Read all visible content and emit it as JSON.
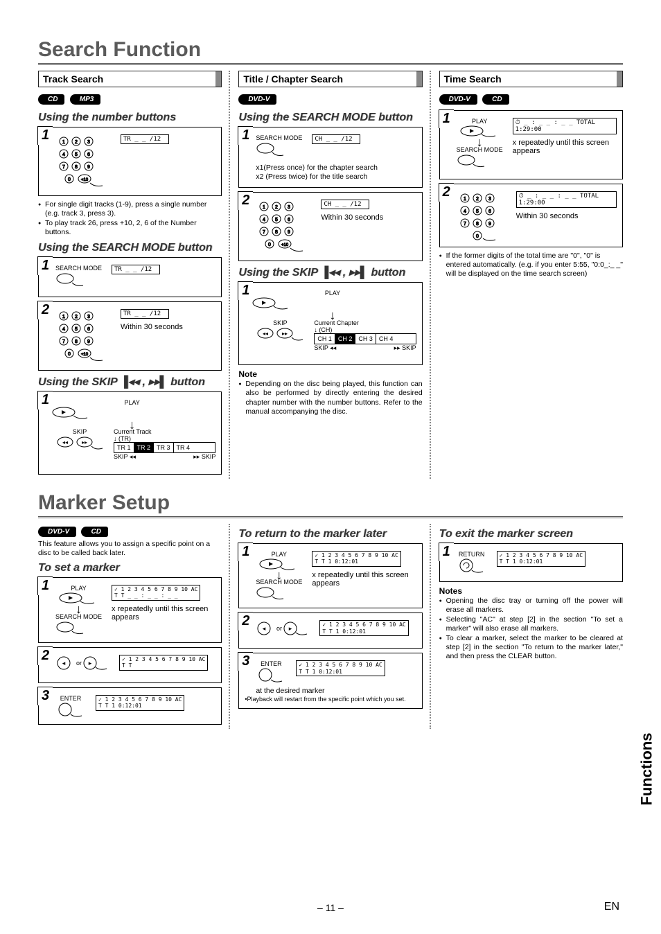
{
  "page": {
    "title1": "Search Function",
    "title2": "Marker Setup",
    "pageNumber": "– 11 –",
    "lang": "EN",
    "sideTab": "Functions"
  },
  "search": {
    "track": {
      "header": "Track Search",
      "badges": [
        "CD",
        "MP3"
      ],
      "numberButtons": {
        "title": "Using the number buttons",
        "display": "TR   _ _ /12",
        "notes": [
          "For single digit tracks (1-9), press a single number (e.g. track 3, press 3).",
          "To play track 26, press +10, 2, 6 of the Number buttons."
        ]
      },
      "searchMode": {
        "title": "Using the SEARCH MODE button",
        "btnLabel": "SEARCH MODE",
        "display": "TR   _ _ /12",
        "within": "Within 30 seconds"
      },
      "skip": {
        "title_pre": "Using the SKIP ",
        "title_post": " button",
        "playLabel": "PLAY",
        "skipLabel": "SKIP",
        "currentLabel": "Current Track",
        "unit": "(TR)",
        "cells": [
          "TR 1",
          "TR 2",
          "TR 3",
          "TR 4"
        ],
        "leftLabel": "SKIP ◂◂",
        "rightLabel": "▸▸ SKIP"
      }
    },
    "titleChapter": {
      "header": "Title / Chapter Search",
      "badges": [
        "DVD-V"
      ],
      "searchMode": {
        "title": "Using the SEARCH MODE button",
        "btnLabel": "SEARCH MODE",
        "display": "CH   _ _ /12",
        "line1": "x1(Press once) for the chapter search",
        "line2": "x2 (Press twice) for the title search",
        "within": "Within 30 seconds"
      },
      "skip": {
        "title_pre": "Using the SKIP ",
        "title_post": " button",
        "playLabel": "PLAY",
        "skipLabel": "SKIP",
        "currentLabel": "Current Chapter",
        "unit": "(CH)",
        "cells": [
          "CH 1",
          "CH 2",
          "CH 3",
          "CH 4"
        ],
        "leftLabel": "SKIP ◂◂",
        "rightLabel": "▸▸ SKIP"
      },
      "note": {
        "title": "Note",
        "text": "Depending on the disc being played, this function can also be performed by directly entering the desired chapter number with the number buttons. Refer to the manual accompanying the disc."
      }
    },
    "time": {
      "header": "Time Search",
      "badges": [
        "DVD-V",
        "CD"
      ],
      "step1": {
        "playLabel": "PLAY",
        "btnLabel": "SEARCH MODE",
        "display": "⏱ _ : _ _ : _ _   TOTAL 1:29:00",
        "hint": "x repeatedly until this screen appears"
      },
      "step2": {
        "display": "⏱ _ : _ _ : _ _   TOTAL 1:29:00",
        "within": "Within 30 seconds"
      },
      "note": "If the former digits of the total time are \"0\", \"0\" is entered automatically. (e.g. if you enter 5:55, \"0:0_:_ _\" will be displayed on the time search screen)"
    }
  },
  "marker": {
    "intro": {
      "badges": [
        "DVD-V",
        "CD"
      ],
      "text": "This feature allows you to assign a specific point on a disc to be called back later."
    },
    "set": {
      "title": "To set a marker",
      "playLabel": "PLAY",
      "btnLabel": "SEARCH MODE",
      "hint": "x repeatedly until this screen appears",
      "orLabel": "or",
      "enterLabel": "ENTER",
      "disp1": {
        "row": "✓ 1 2 3 4 5 6 7 8 9 10 AC",
        "line": "T T  _ _ : _ _ : _ _"
      },
      "disp2": {
        "row": "✓ 1 2 3 4 5 6 7 8 9 10 AC",
        "line": "T T"
      },
      "disp3": {
        "row": "✓ 1 2 3 4 5 6 7 8 9 10 AC",
        "line": "T T   1   0:12:01"
      }
    },
    "return": {
      "title": "To return to the marker later",
      "playLabel": "PLAY",
      "btnLabel": "SEARCH MODE",
      "hint": "x repeatedly until this screen appears",
      "orLabel": "or",
      "enterLabel": "ENTER",
      "atDesired": "at the desired marker",
      "playbackNote": "Playback will restart from the specific point which you set.",
      "disp1": {
        "row": "✓ 1 2 3 4 5 6 7 8 9 10 AC",
        "line": "T T   1   0:12:01"
      },
      "disp2": {
        "row": "✓ 1 2 3 4 5 6 7 8 9 10 AC",
        "line": "T T   1   0:12:01"
      },
      "disp3": {
        "row": "✓ 1 2 3 4 5 6 7 8 9 10 AC",
        "line": "T T   1   0:12:01"
      }
    },
    "exit": {
      "title": "To exit the marker screen",
      "returnLabel": "RETURN",
      "disp": {
        "row": "✓ 1 2 3 4 5 6 7 8 9 10 AC",
        "line": "T T   1   0:12:01"
      },
      "notesTitle": "Notes",
      "notes": [
        "Opening the disc tray or turning off the power will erase all markers.",
        "Selecting \"AC\" at step [2] in the section \"To set a marker\" will also erase all markers.",
        "To clear a marker, select the marker to be cleared at step [2] in the section \"To return to the marker later,\" and then press the CLEAR button."
      ]
    }
  }
}
